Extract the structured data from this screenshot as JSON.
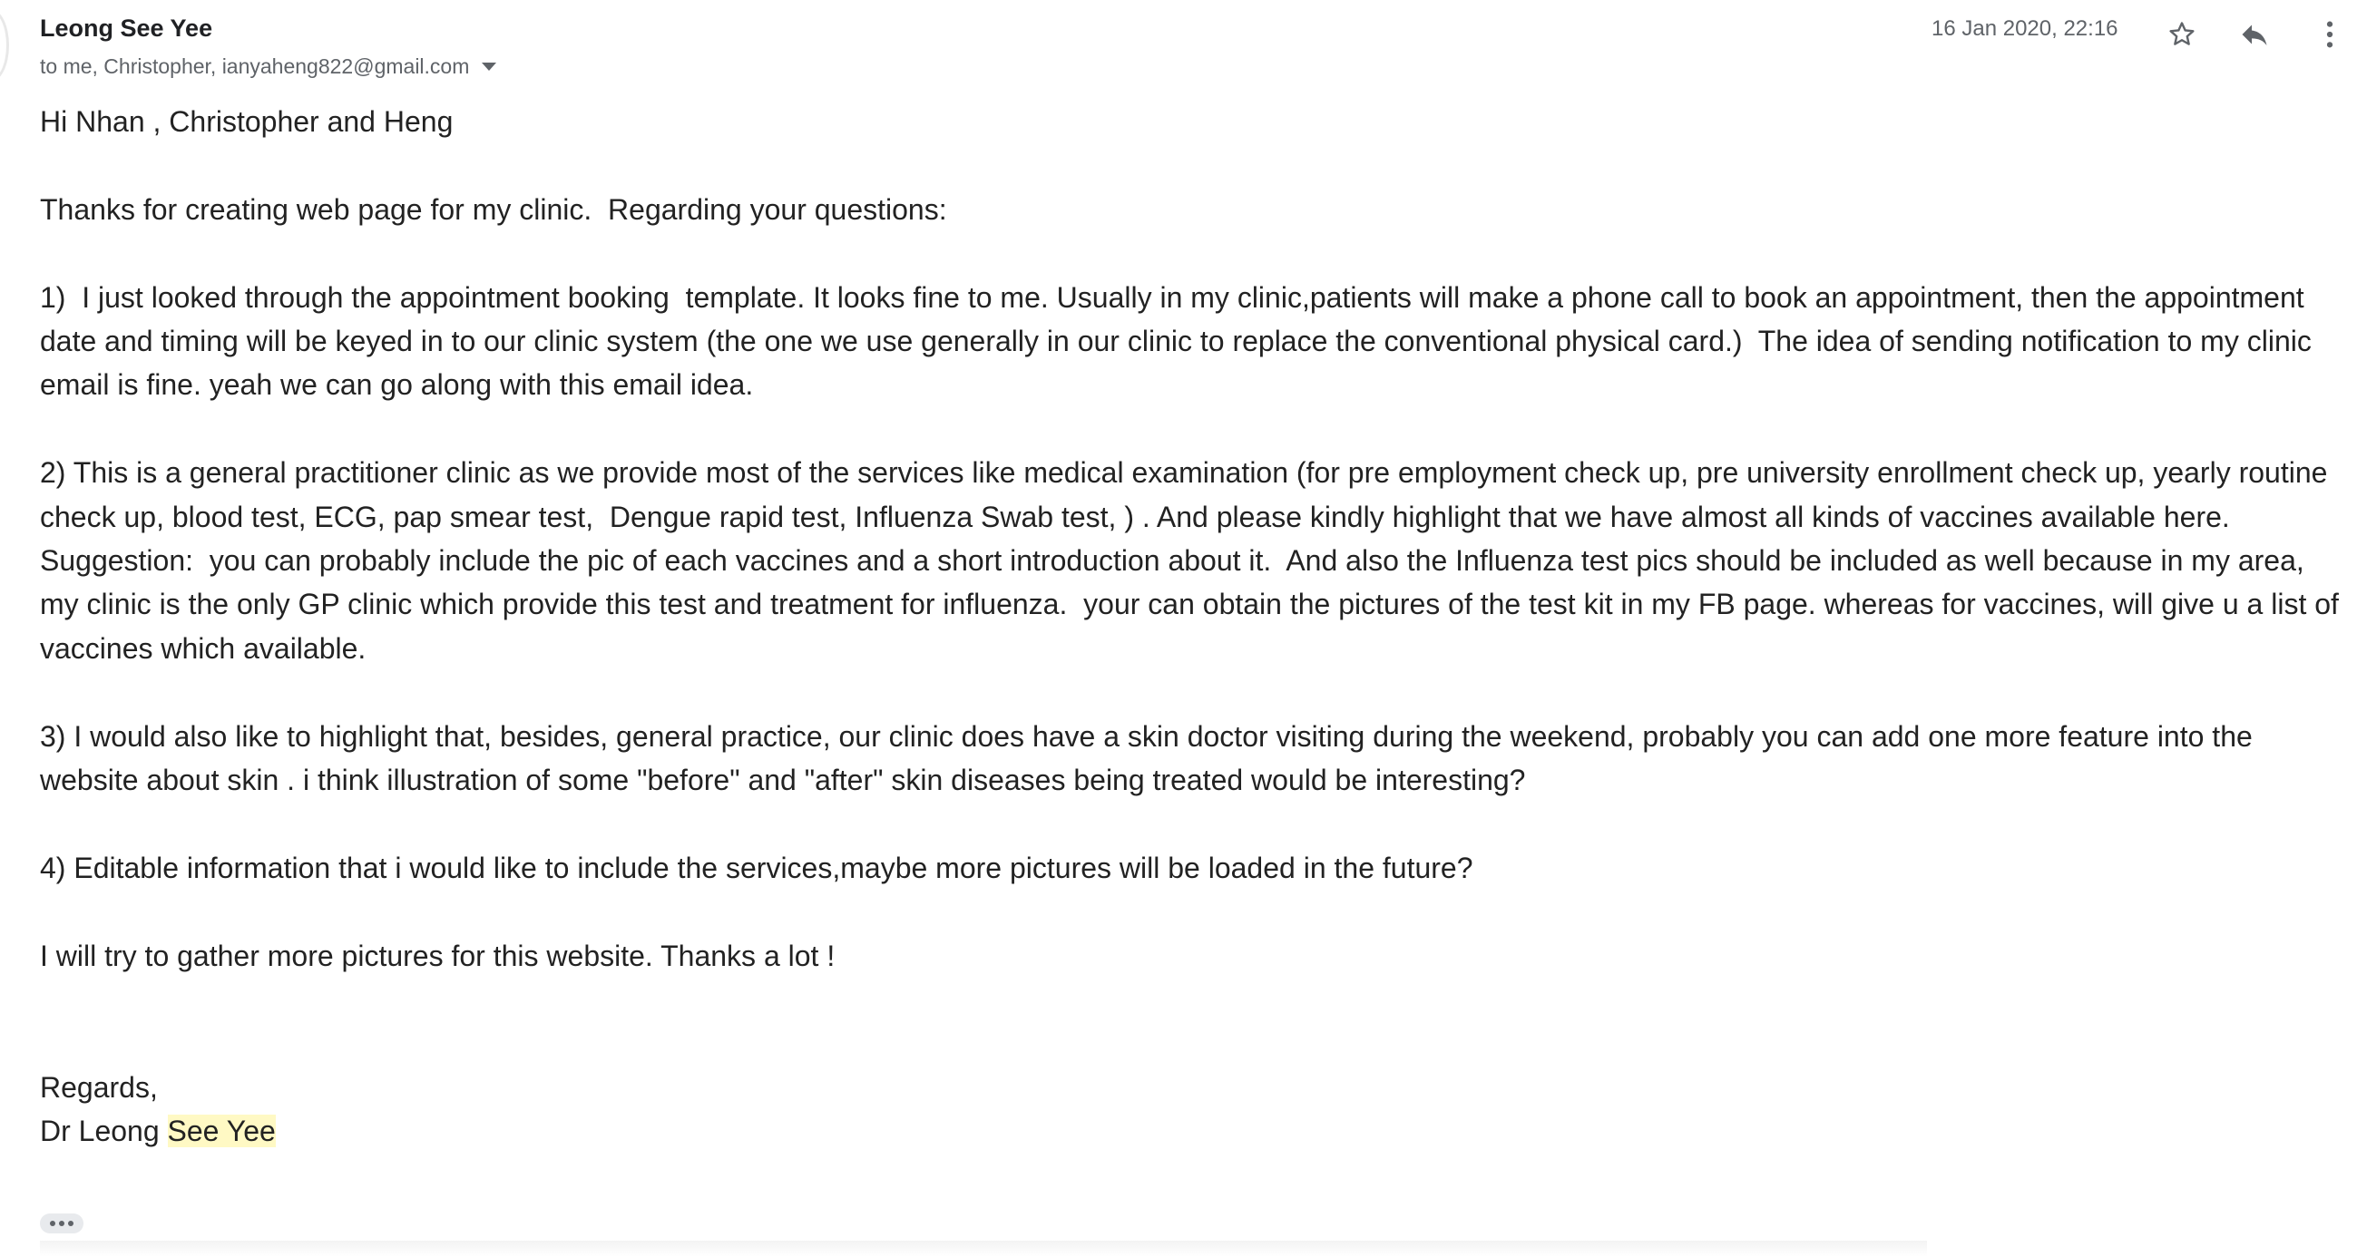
{
  "header": {
    "sender": "Leong See Yee",
    "recipients": "to me, Christopher, ianyaheng822@gmail.com",
    "timestamp": "16 Jan 2020, 22:16"
  },
  "icons": {
    "star": "star-icon",
    "reply": "reply-icon",
    "more": "more-vert-icon",
    "recipients_dropdown": "caret-down-icon",
    "show_trimmed": "ellipsis-icon"
  },
  "colors": {
    "highlight": "#fff9c4",
    "secondary_text": "#5f6368",
    "body_text": "#222222"
  },
  "message": {
    "greeting": "Hi Nhan , Christopher and Heng",
    "intro": "Thanks for creating web page for my clinic.  Regarding your questions:",
    "point1": "1)  I just looked through the appointment booking  template. It looks fine to me. Usually in my clinic,patients will make a phone call to book an appointment, then the appointment date and timing will be keyed in to our clinic system (the one we use generally in our clinic to replace the conventional physical card.)  The idea of sending notification to my clinic email is fine. yeah we can go along with this email idea.",
    "point2": "2) This is a general practitioner clinic as we provide most of the services like medical examination (for pre employment check up, pre university enrollment check up, yearly routine check up, blood test, ECG, pap smear test,  Dengue rapid test, Influenza Swab test, ) . And please kindly highlight that we have almost all kinds of vaccines available here.",
    "suggestion": "Suggestion:  you can probably include the pic of each vaccines and a short introduction about it.  And also the Influenza test pics should be included as well because in my area, my clinic is the only GP clinic which provide this test and treatment for influenza.  your can obtain the pictures of the test kit in my FB page. whereas for vaccines, will give u a list of vaccines which available.",
    "point3": "3) I would also like to highlight that, besides, general practice, our clinic does have a skin doctor visiting during the weekend, probably you can add one more feature into the website about skin . i think illustration of some \"before\" and \"after\" skin diseases being treated would be interesting?",
    "point4": "4) Editable information that i would like to include the services,maybe more pictures will be loaded in the future?",
    "closing": "I will try to gather more pictures for this website. Thanks a lot !",
    "regards": "Regards,",
    "signature_prefix": "Dr Leong ",
    "signature_highlight": "See Yee"
  }
}
